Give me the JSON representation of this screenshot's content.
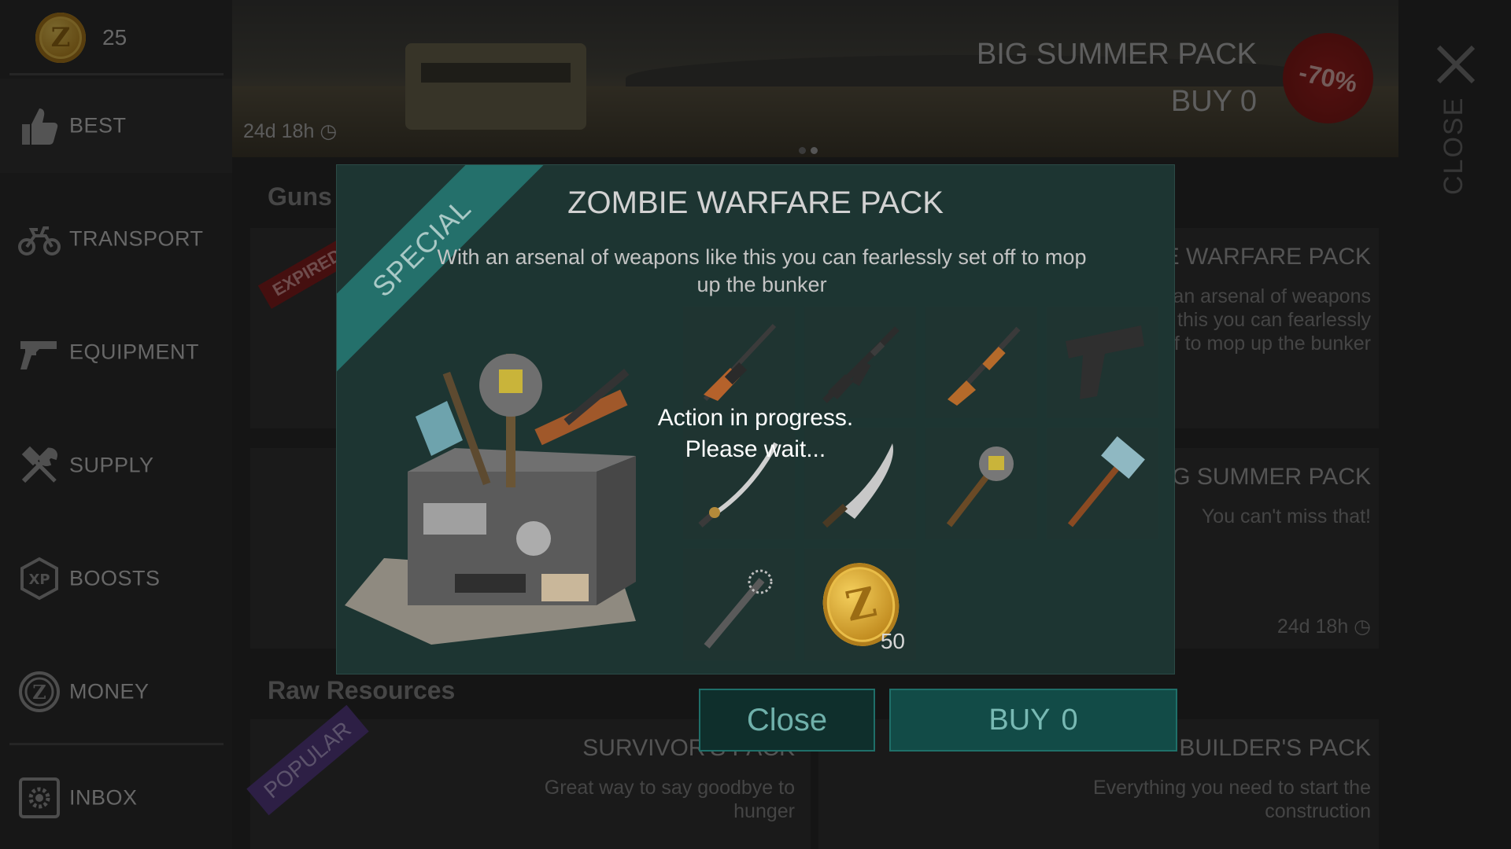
{
  "currency": {
    "balance": "25",
    "coin_letter": "Z"
  },
  "sidebar": {
    "items": [
      {
        "label": "BEST",
        "icon": "thumbs-up-icon"
      },
      {
        "label": "TRANSPORT",
        "icon": "motorcycle-icon"
      },
      {
        "label": "EQUIPMENT",
        "icon": "pistol-icon"
      },
      {
        "label": "SUPPLY",
        "icon": "tools-icon"
      },
      {
        "label": "BOOSTS",
        "icon": "xp-badge-icon",
        "badge_text": "XP"
      },
      {
        "label": "MONEY",
        "icon": "coin-icon",
        "badge_text": "Z"
      },
      {
        "label": "INBOX",
        "icon": "inbox-gear-icon"
      }
    ]
  },
  "banner": {
    "title": "BIG SUMMER PACK",
    "buy": "BUY 0",
    "discount": "-70%",
    "timer": "24d 18h"
  },
  "close_label": "CLOSE",
  "sections": {
    "guns": "Guns",
    "raw_resources": "Raw Resources"
  },
  "background_cards": {
    "expired_tag": "EXPIRED",
    "zombie_title": "ZOMBIE WARFARE PACK",
    "zombie_desc": "With an arsenal of weapons like this you can fearlessly set off to mop up the bunker",
    "summer_title": "BIG SUMMER PACK",
    "summer_desc": "You can't miss that!",
    "summer_timer": "24d 18h",
    "popular_tag": "POPULAR",
    "survivor_title": "SURVIVOR'S PACK",
    "survivor_desc": "Great way to say goodbye to hunger",
    "builder_title": "BUILDER'S PACK",
    "builder_desc": "Everything you need to start the construction"
  },
  "modal": {
    "ribbon": "SPECIAL",
    "title": "ZOMBIE WARFARE PACK",
    "description": "With an arsenal of weapons like this you can fearlessly set off to mop up the bunker",
    "items": [
      {
        "name": "hunting-rifle"
      },
      {
        "name": "assault-rifle"
      },
      {
        "name": "shotgun"
      },
      {
        "name": "pistol"
      },
      {
        "name": "katana"
      },
      {
        "name": "machete"
      },
      {
        "name": "spiked-mace"
      },
      {
        "name": "sledgehammer"
      },
      {
        "name": "spiked-bat"
      },
      {
        "name": "coins",
        "quantity": "50"
      }
    ],
    "progress_line1": "Action in progress.",
    "progress_line2": "Please wait...",
    "close_button": "Close",
    "buy_label": "BUY",
    "buy_price": "0"
  }
}
